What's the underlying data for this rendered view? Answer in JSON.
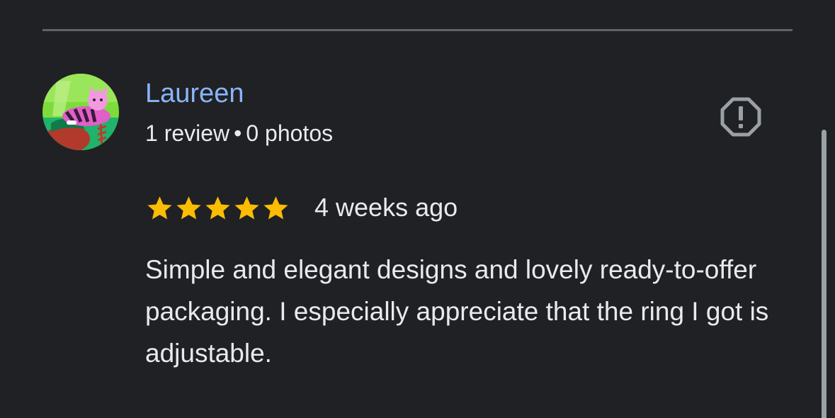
{
  "review": {
    "reviewer_name": "Laureen",
    "review_count": "1 review",
    "separator": "•",
    "photo_count": "0 photos",
    "rating": 5,
    "rating_max": 5,
    "time_ago": "4 weeks ago",
    "text": "Simple and elegant designs and lovely ready-to-offer packaging. I especially appreciate that the ring I got is adjustable."
  },
  "icons": {
    "report": "report-flag-icon",
    "star": "star-icon",
    "avatar": "cat-avatar-image"
  },
  "colors": {
    "background": "#202124",
    "name_link": "#8ab4f8",
    "text": "#e8eaed",
    "star": "#fbbc04",
    "icon": "#9aa0a6",
    "divider": "#5f6368"
  }
}
